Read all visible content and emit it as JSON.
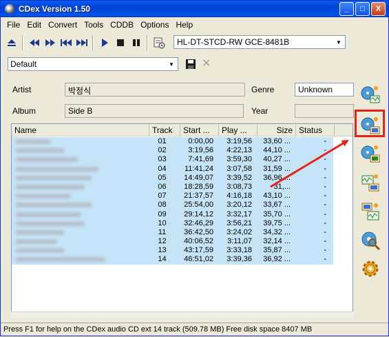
{
  "window": {
    "title": "CDex Version 1.50"
  },
  "title_buttons": {
    "minimize": "_",
    "maximize": "□",
    "close": "X"
  },
  "menu": [
    "File",
    "Edit",
    "Convert",
    "Tools",
    "CDDB",
    "Options",
    "Help"
  ],
  "toolbar": {
    "drive": "HL-DT-STCD-RW GCE-8481B",
    "icons": [
      "eject-icon",
      "rewind-icon",
      "fast-forward-icon",
      "previous-track-icon",
      "next-track-icon",
      "play-icon",
      "stop-icon",
      "pause-icon",
      "cd-info-icon"
    ]
  },
  "profile": {
    "value": "Default"
  },
  "album_info": {
    "artist_label": "Artist",
    "artist_value": "박정식",
    "album_label": "Album",
    "album_value": "Side B",
    "genre_label": "Genre",
    "genre_value": "Unknown",
    "year_label": "Year",
    "year_value": ""
  },
  "columns": [
    "Name",
    "Track",
    "Start ...",
    "Play ...",
    "Size",
    "Status"
  ],
  "tracks": [
    {
      "track": "01",
      "start": "0:00,00",
      "play": "3:19,56",
      "size": "33,60 ...",
      "status": "-"
    },
    {
      "track": "02",
      "start": "3:19,56",
      "play": "4:22,13",
      "size": "44,10 ...",
      "status": "-"
    },
    {
      "track": "03",
      "start": "7:41,69",
      "play": "3:59,30",
      "size": "40,27 ...",
      "status": "-"
    },
    {
      "track": "04",
      "start": "11:41,24",
      "play": "3:07,58",
      "size": "31,59 ...",
      "status": "-"
    },
    {
      "track": "05",
      "start": "14:49,07",
      "play": "3:39,52",
      "size": "36,96 ...",
      "status": "-"
    },
    {
      "track": "06",
      "start": "18:28,59",
      "play": "3:08,73",
      "size": "31,...",
      "status": "-"
    },
    {
      "track": "07",
      "start": "21:37,57",
      "play": "4:16,18",
      "size": "43,10 ...",
      "status": "-"
    },
    {
      "track": "08",
      "start": "25:54,00",
      "play": "3:20,12",
      "size": "33,67 ...",
      "status": "-"
    },
    {
      "track": "09",
      "start": "29:14,12",
      "play": "3:32,17",
      "size": "35,70 ...",
      "status": "-"
    },
    {
      "track": "10",
      "start": "32:46,29",
      "play": "3:56,21",
      "size": "39,75 ...",
      "status": "-"
    },
    {
      "track": "11",
      "start": "36:42,50",
      "play": "3:24,02",
      "size": "34,32 ...",
      "status": "-"
    },
    {
      "track": "12",
      "start": "40:06,52",
      "play": "3:11,07",
      "size": "32,14 ...",
      "status": "-"
    },
    {
      "track": "13",
      "start": "43:17,59",
      "play": "3:33,18",
      "size": "35,87 ...",
      "status": "-"
    },
    {
      "track": "14",
      "start": "46:51,02",
      "play": "3:39,36",
      "size": "36,92 ...",
      "status": "-"
    }
  ],
  "status_bar": "Press F1 for help on the CDex audio CD ext 14 track (509.78 MB) Free disk space  8407 MB",
  "colors": {
    "highlight": "#e8221a",
    "selection": "#c5e4f7",
    "titlebar": "#0a5ee9"
  }
}
